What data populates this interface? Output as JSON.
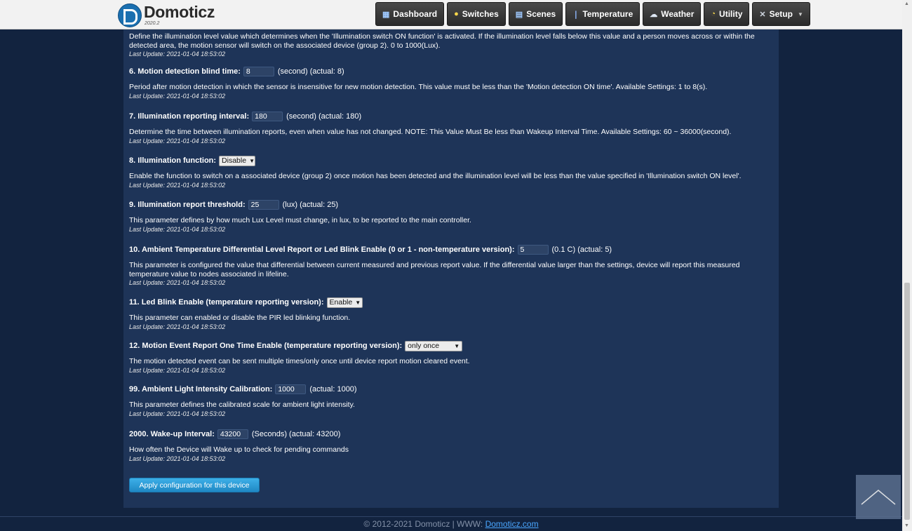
{
  "header": {
    "logo_text": "Domoticz",
    "logo_version": "2020.2",
    "nav": [
      {
        "label": "Dashboard",
        "icon": "dashboard-icon"
      },
      {
        "label": "Switches",
        "icon": "bulb-icon"
      },
      {
        "label": "Scenes",
        "icon": "scenes-icon"
      },
      {
        "label": "Temperature",
        "icon": "thermometer-icon"
      },
      {
        "label": "Weather",
        "icon": "cloud-icon"
      },
      {
        "label": "Utility",
        "icon": "utility-icon"
      },
      {
        "label": "Setup",
        "icon": "tools-icon"
      }
    ]
  },
  "params": {
    "p5": {
      "desc": "Define the illumination level value which determines when the 'Illumination switch ON function' is activated. If the illumination level falls below this value and a person moves across or within the detected area, the motion sensor will switch on the associated device (group 2). 0 to 1000(Lux).",
      "update": "Last Update: 2021-01-04 18:53:02"
    },
    "p6": {
      "label": "6. Motion detection blind time:",
      "value": "8",
      "unit": "(second) (actual: 8)",
      "desc": "Period after motion detection in which the sensor is insensitive for new motion detection. This value must be less than the 'Motion detection ON time'. Available Settings: 1 to 8(s).",
      "update": "Last Update: 2021-01-04 18:53:02"
    },
    "p7": {
      "label": "7. Illumination reporting interval:",
      "value": "180",
      "unit": "(second) (actual: 180)",
      "desc": "Determine the time between illumination reports, even when value has not changed. NOTE: This Value Must Be less than Wakeup Interval Time. Available Settings: 60 ~ 36000(second).",
      "update": "Last Update: 2021-01-04 18:53:02"
    },
    "p8": {
      "label": "8. Illumination function:",
      "value": "Disable",
      "desc": "Enable the function to switch on a associated device (group 2) once motion has been detected and the illumination level will be less than the value specified in 'Illumination switch ON level'.",
      "update": "Last Update: 2021-01-04 18:53:02"
    },
    "p9": {
      "label": "9. Illumination report threshold:",
      "value": "25",
      "unit": "(lux) (actual: 25)",
      "desc": "This parameter defines by how much Lux Level must change, in lux, to be reported to the main controller.",
      "update": "Last Update: 2021-01-04 18:53:02"
    },
    "p10": {
      "label": "10. Ambient Temperature Differential Level Report or Led Blink Enable (0 or 1 - non-temperature version):",
      "value": "5",
      "unit": "(0.1 C) (actual: 5)",
      "desc": "This parameter is configured the value that differential between current measured and previous report value. If the differential value larger than the settings, device will report this measured temperature value to nodes associated in lifeline.",
      "update": "Last Update: 2021-01-04 18:53:02"
    },
    "p11": {
      "label": "11. Led Blink Enable (temperature reporting version):",
      "value": "Enable",
      "desc": "This parameter can enabled or disable the PIR led blinking function.",
      "update": "Last Update: 2021-01-04 18:53:02"
    },
    "p12": {
      "label": "12. Motion Event Report One Time Enable (temperature reporting version):",
      "value": "only once",
      "desc": "The motion detected event can be sent multiple times/only once until device report motion cleared event.",
      "update": "Last Update: 2021-01-04 18:53:02"
    },
    "p99": {
      "label": "99. Ambient Light Intensity Calibration:",
      "value": "1000",
      "unit": "(actual: 1000)",
      "desc": "This parameter defines the calibrated scale for ambient light intensity.",
      "update": "Last Update: 2021-01-04 18:53:02"
    },
    "p2000": {
      "label": "2000. Wake-up Interval:",
      "value": "43200",
      "unit": "(Seconds) (actual: 43200)",
      "desc": "How often the Device will Wake up to check for pending commands",
      "update": "Last Update: 2021-01-04 18:53:02"
    }
  },
  "apply_label": "Apply configuration for this device",
  "footer": {
    "text": "© 2012-2021 Domoticz | WWW:",
    "link": "Domoticz.com"
  }
}
